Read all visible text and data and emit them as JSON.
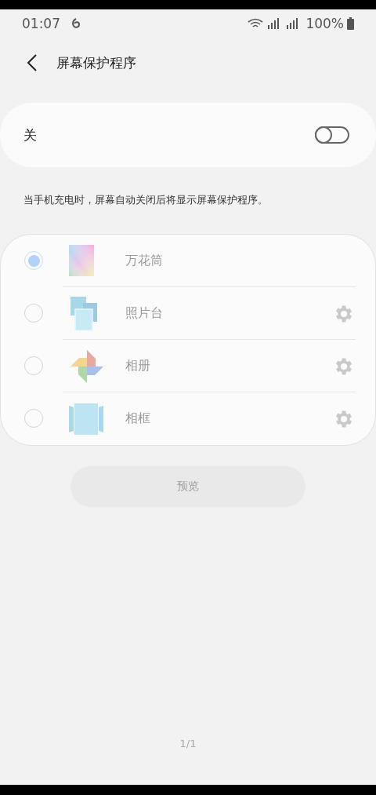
{
  "status_bar": {
    "time": "01:07",
    "battery": "100%"
  },
  "header": {
    "title": "屏幕保护程序"
  },
  "master_switch": {
    "label": "关",
    "on": false
  },
  "description": "当手机充电时，屏幕自动关闭后将显示屏幕保护程序。",
  "screensavers": {
    "disabled": true,
    "items": [
      {
        "label": "万花筒",
        "kind": "gradient",
        "selected": true,
        "has_settings": false
      },
      {
        "label": "照片台",
        "kind": "photo-table",
        "selected": false,
        "has_settings": true
      },
      {
        "label": "相册",
        "kind": "pinwheel",
        "selected": false,
        "has_settings": true
      },
      {
        "label": "相框",
        "kind": "frame",
        "selected": false,
        "has_settings": true
      }
    ]
  },
  "preview_button": {
    "label": "预览",
    "disabled": true
  },
  "page_indicator": "1/1"
}
